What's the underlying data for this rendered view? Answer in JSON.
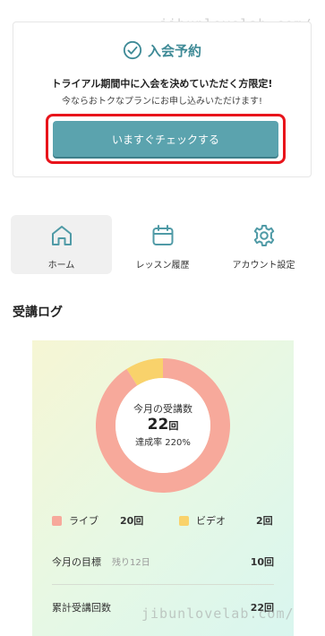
{
  "watermark": "jibunlovelab.com/",
  "join": {
    "title": "入会予約",
    "lead": "トライアル期間中に入会を決めていただく方限定!",
    "sub": "今ならおトクなプランにお申し込みいただけます!",
    "cta_label": "いますぐチェックする",
    "accent": "#5ba3ae",
    "highlight": "#e8141b"
  },
  "nav": {
    "items": [
      {
        "label": "ホーム",
        "icon": "home-icon",
        "active": true
      },
      {
        "label": "レッスン履歴",
        "icon": "calendar-icon",
        "active": false
      },
      {
        "label": "アカウント設定",
        "icon": "gear-icon",
        "active": false
      }
    ]
  },
  "log": {
    "section_title": "受講ログ",
    "month_label": "今月の受講数",
    "month_count": "22",
    "month_unit": "回",
    "rate_text": "達成率 220%",
    "live_label": "ライブ",
    "live_value": "20回",
    "video_label": "ビデオ",
    "video_value": "2回",
    "goal_label": "今月の目標",
    "goal_hint": "残り12日",
    "goal_value": "10回",
    "total_label": "累計受講回数",
    "total_value": "22回",
    "live_color": "#f7a99b",
    "video_color": "#f9d26b"
  },
  "chart_data": {
    "type": "pie",
    "categories": [
      "ライブ",
      "ビデオ"
    ],
    "values": [
      20,
      2
    ],
    "title": "今月の受講数"
  }
}
